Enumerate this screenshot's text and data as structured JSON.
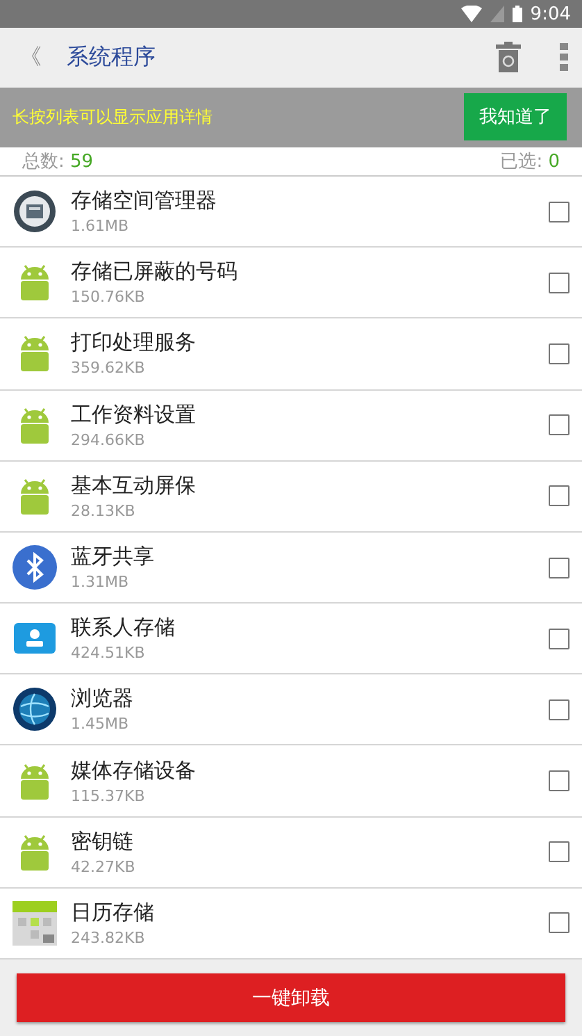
{
  "status_bar": {
    "time": "9:04"
  },
  "app_bar": {
    "back": "《",
    "title": "系统程序"
  },
  "hint": {
    "text": "长按列表可以显示应用详情",
    "button": "我知道了"
  },
  "counts": {
    "total_label": "总数: ",
    "total": "59",
    "selected_label": "已选: ",
    "selected": "0"
  },
  "apps": [
    {
      "kind": "storage",
      "name": "存储空间管理器",
      "size": "1.61MB",
      "checked": false
    },
    {
      "kind": "android",
      "name": "存储已屏蔽的号码",
      "size": "150.76KB",
      "checked": false
    },
    {
      "kind": "android",
      "name": "打印处理服务",
      "size": "359.62KB",
      "checked": false
    },
    {
      "kind": "android",
      "name": "工作资料设置",
      "size": "294.66KB",
      "checked": false
    },
    {
      "kind": "android",
      "name": "基本互动屏保",
      "size": "28.13KB",
      "checked": false
    },
    {
      "kind": "bluetooth",
      "name": "蓝牙共享",
      "size": "1.31MB",
      "checked": false
    },
    {
      "kind": "contacts",
      "name": "联系人存储",
      "size": "424.51KB",
      "checked": false
    },
    {
      "kind": "browser",
      "name": "浏览器",
      "size": "1.45MB",
      "checked": false
    },
    {
      "kind": "android",
      "name": "媒体存储设备",
      "size": "115.37KB",
      "checked": false
    },
    {
      "kind": "android",
      "name": "密钥链",
      "size": "42.27KB",
      "checked": false
    },
    {
      "kind": "calendar",
      "name": "日历存储",
      "size": "243.82KB",
      "checked": false
    }
  ],
  "uninstall_button": "一键卸载"
}
